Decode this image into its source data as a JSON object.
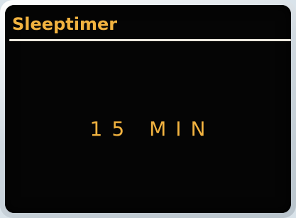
{
  "screen": {
    "title": "Sleeptimer",
    "value": "15 MIN"
  },
  "colors": {
    "text": "#f2b340",
    "background": "#050505",
    "divider": "#ece8de"
  }
}
